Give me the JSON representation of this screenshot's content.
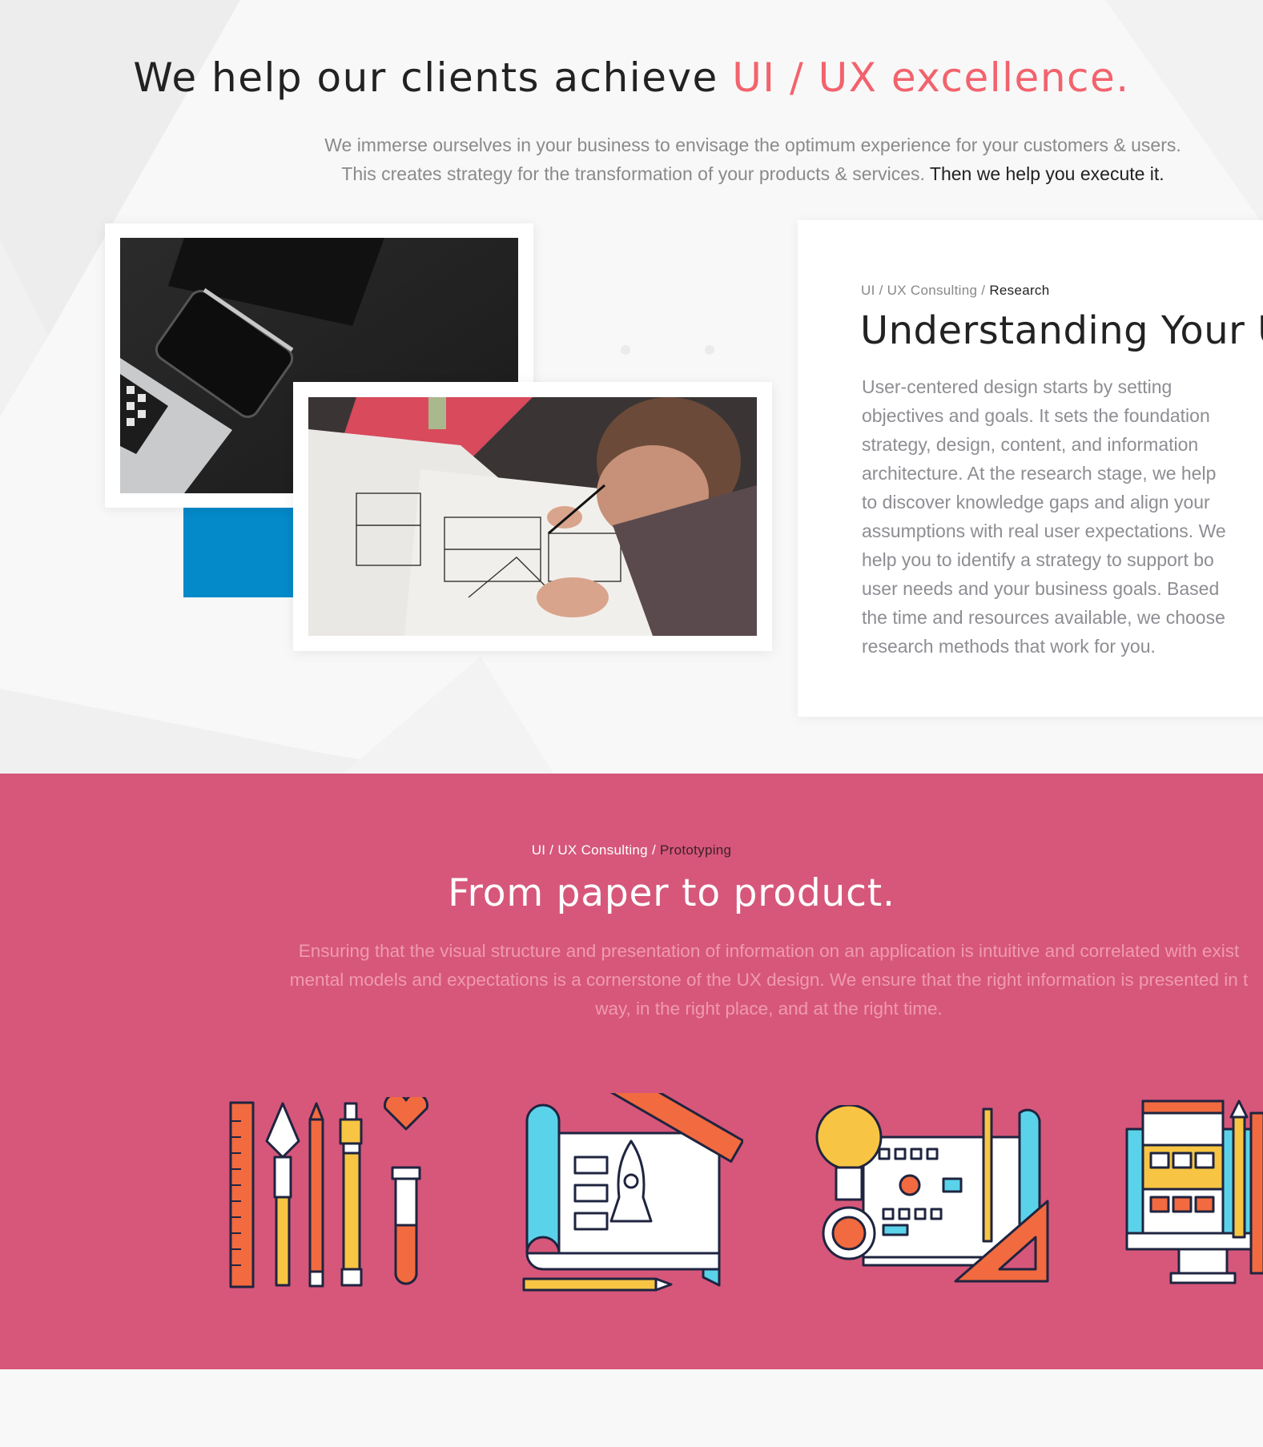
{
  "hero": {
    "title_main": "We help our clients achieve ",
    "title_accent": "UI / UX excellence.",
    "sub_line1": "We immerse ourselves in your business to envisage the optimum experience for your customers & users.",
    "sub_line2": "This creates strategy for the transformation of your products & services. ",
    "sub_dark": "Then we help you execute it."
  },
  "research": {
    "crumb_parent": "UI / UX Consulting / ",
    "crumb_current": "Research",
    "title": "Understanding Your U",
    "body": "User-centered design starts by setting\nobjectives and goals. It sets the foundation\nstrategy, design, content, and information\narchitecture. At the research stage, we help\nto discover knowledge gaps and align your\nassumptions with real user expectations. We\nhelp you to identify a strategy to support bo\nuser needs and your business goals. Based\nthe time and resources available, we choose\nresearch methods that work for you."
  },
  "prototyping": {
    "crumb_parent": "UI / UX Consulting / ",
    "crumb_current": "Prototyping",
    "title": "From paper to product.",
    "body": "Ensuring that the visual structure and presentation of information on an application is intuitive and correlated with exist\nmental models and expectations is a cornerstone of the UX design. We ensure that the right information is presented in t\nway, in the right place, and at the right time."
  },
  "colors": {
    "accent": "#f2636d",
    "pink_section": "#d6577a",
    "blue_block": "#0489c9"
  },
  "icons": [
    "design-tools-icon",
    "blueprint-rocket-icon",
    "idea-flowchart-icon",
    "web-layout-monitor-icon"
  ]
}
